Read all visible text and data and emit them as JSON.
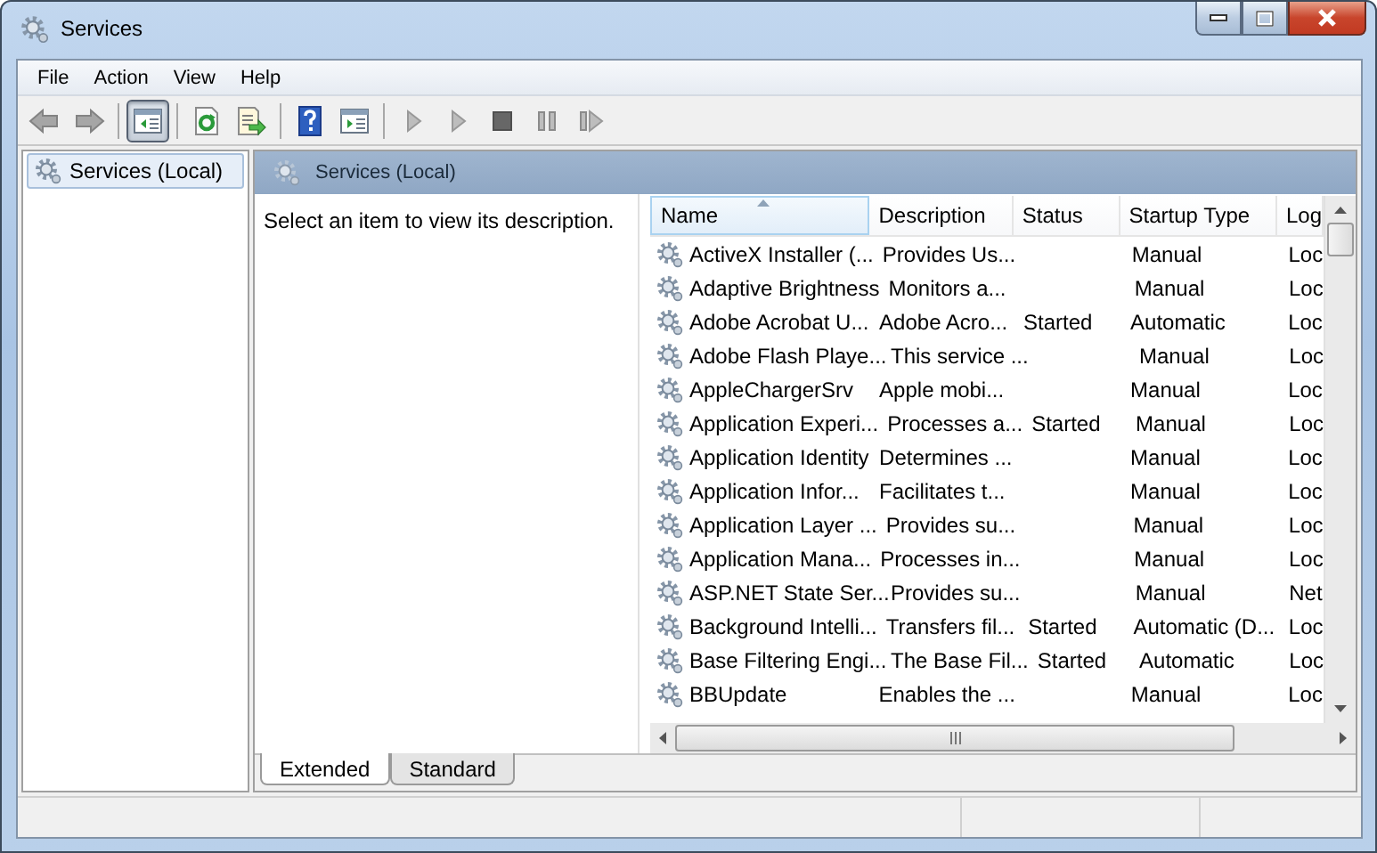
{
  "window": {
    "title": "Services"
  },
  "menu": [
    "File",
    "Action",
    "View",
    "Help"
  ],
  "toolbar_groups": [
    {
      "items": [
        {
          "kind": "back",
          "disabled": true,
          "pressed": false
        },
        {
          "kind": "forward",
          "disabled": true,
          "pressed": false
        }
      ]
    },
    {
      "items": [
        {
          "kind": "tree",
          "disabled": false,
          "pressed": true
        }
      ]
    },
    {
      "items": [
        {
          "kind": "refresh",
          "disabled": false,
          "pressed": false
        },
        {
          "kind": "export",
          "disabled": false,
          "pressed": false
        }
      ]
    },
    {
      "items": [
        {
          "kind": "help",
          "disabled": false,
          "pressed": false
        },
        {
          "kind": "pane",
          "disabled": false,
          "pressed": false
        }
      ]
    },
    {
      "items": [
        {
          "kind": "start",
          "disabled": true,
          "pressed": false
        },
        {
          "kind": "start",
          "disabled": true,
          "pressed": false
        },
        {
          "kind": "stop",
          "disabled": true,
          "pressed": false
        },
        {
          "kind": "pause",
          "disabled": true,
          "pressed": false
        },
        {
          "kind": "resume",
          "disabled": true,
          "pressed": false
        }
      ]
    }
  ],
  "tree": {
    "items": [
      {
        "label": "Services (Local)",
        "selected": true
      }
    ]
  },
  "panel": {
    "title": "Services (Local)",
    "description": "Select an item to view its description."
  },
  "table": {
    "columns": [
      {
        "label": "Name",
        "sorted": true
      },
      {
        "label": "Description",
        "sorted": false
      },
      {
        "label": "Status",
        "sorted": false
      },
      {
        "label": "Startup Type",
        "sorted": false
      },
      {
        "label": "Log",
        "sorted": false
      }
    ],
    "rows": [
      {
        "name": "ActiveX Installer (...",
        "description": "Provides Us...",
        "startup_type": "Manual",
        "column_5": "Loc"
      },
      {
        "name": "Adaptive Brightness",
        "description": "Monitors a...",
        "startup_type": "Manual",
        "column_5": "Loc"
      },
      {
        "name": "Adobe Acrobat U...",
        "description": "Adobe Acro...",
        "status": "Started",
        "startup_type": "Automatic",
        "column_5": "Loc"
      },
      {
        "name": "Adobe Flash Playe...",
        "description": "This service ...",
        "startup_type": "Manual",
        "column_5": "Loc"
      },
      {
        "name": "AppleChargerSrv",
        "description": "Apple mobi...",
        "startup_type": "Manual",
        "column_5": "Loc"
      },
      {
        "name": "Application Experi...",
        "description": "Processes a...",
        "status": "Started",
        "startup_type": "Manual",
        "column_5": "Loc"
      },
      {
        "name": "Application Identity",
        "description": "Determines ...",
        "startup_type": "Manual",
        "column_5": "Loc"
      },
      {
        "name": "Application Infor...",
        "description": "Facilitates t...",
        "startup_type": "Manual",
        "column_5": "Loc"
      },
      {
        "name": "Application Layer ...",
        "description": "Provides su...",
        "startup_type": "Manual",
        "column_5": "Loc"
      },
      {
        "name": "Application Mana...",
        "description": "Processes in...",
        "startup_type": "Manual",
        "column_5": "Loc"
      },
      {
        "name": "ASP.NET State Ser...",
        "description": "Provides su...",
        "startup_type": "Manual",
        "column_5": "Net"
      },
      {
        "name": "Background Intelli...",
        "description": "Transfers fil...",
        "status": "Started",
        "startup_type": "Automatic (D...",
        "column_5": "Loc"
      },
      {
        "name": "Base Filtering Engi...",
        "description": "The Base Fil...",
        "status": "Started",
        "startup_type": "Automatic",
        "column_5": "Loc"
      },
      {
        "name": "BBUpdate",
        "description": "Enables the ...",
        "startup_type": "Manual",
        "column_5": "Loc"
      }
    ]
  },
  "tabs": [
    {
      "label": "Extended",
      "selected": true
    },
    {
      "label": "Standard",
      "selected": false
    }
  ]
}
